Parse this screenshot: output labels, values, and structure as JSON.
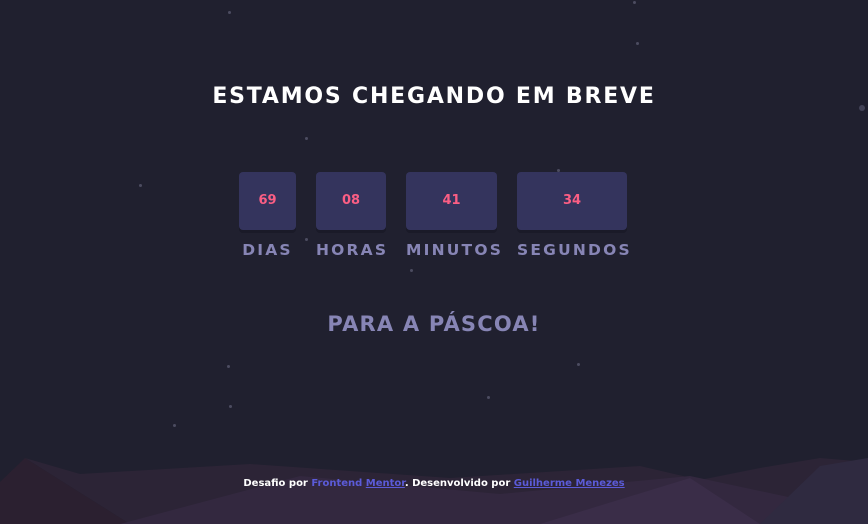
{
  "header": {
    "title": "ESTAMOS CHEGANDO EM BREVE"
  },
  "countdown": [
    {
      "value": "69",
      "label": "DIAS"
    },
    {
      "value": "08",
      "label": "HORAS"
    },
    {
      "value": "41",
      "label": "MINUTOS"
    },
    {
      "value": "34",
      "label": "SEGUNDOS"
    }
  ],
  "subtitle": "PARA A PÁSCOA!",
  "footer": {
    "prefix": "Desafio por",
    "link1_part1": "Frontend",
    "link1_part2": "Mentor",
    "middle": ". Desenvolvido por",
    "link2": "Guilherme Menezes"
  },
  "colors": {
    "background": "#20202f",
    "card": "#34345d",
    "digits": "#fb5e84",
    "label": "#8785b5",
    "link": "#5b5bd8"
  }
}
